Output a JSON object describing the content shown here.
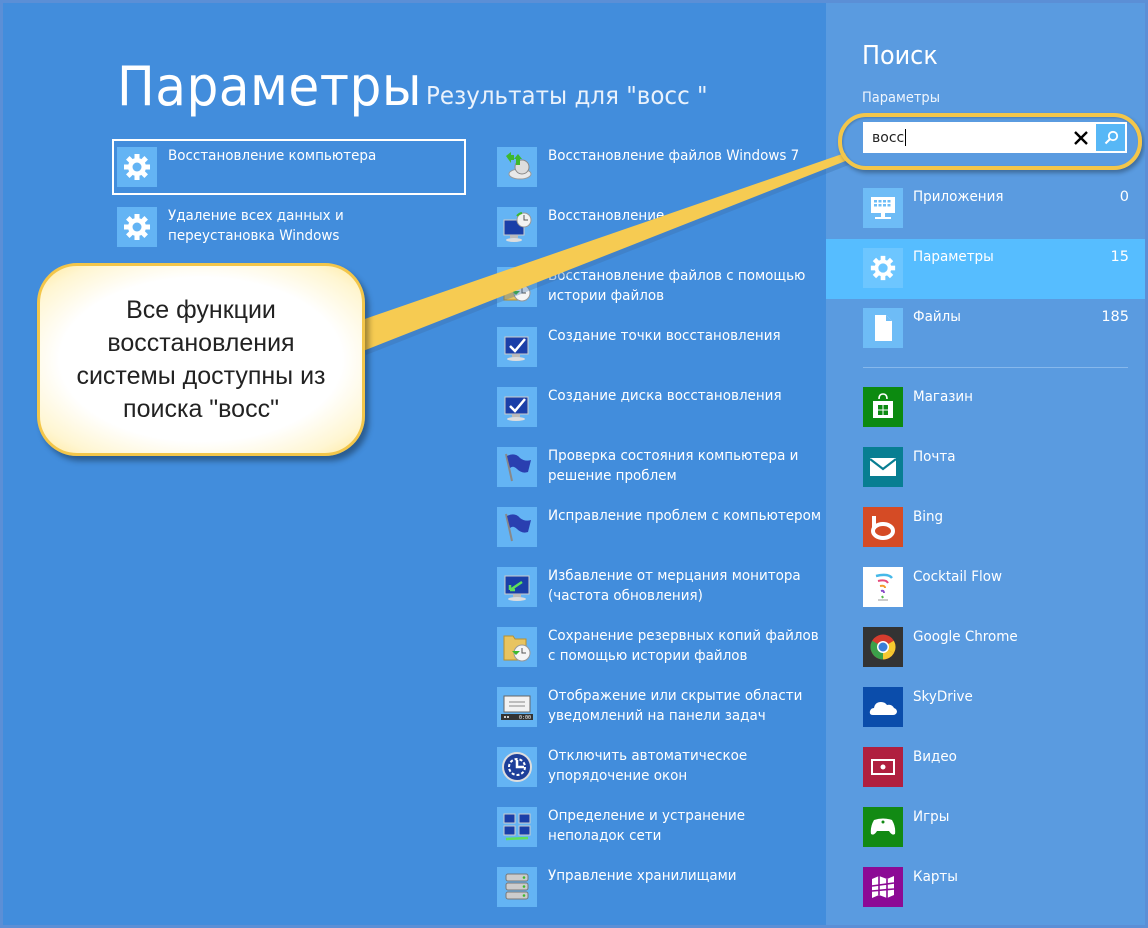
{
  "main": {
    "title": "Параметры",
    "results_heading": "Результаты для \"восс \"",
    "left_column": [
      {
        "label": "Восстановление компьютера",
        "icon": "gear-icon",
        "selected": true
      },
      {
        "label": "Удаление всех данных и переустановка Windows",
        "icon": "gear-icon",
        "selected": false
      }
    ],
    "right_column": [
      {
        "label": "Восстановление файлов Windows 7",
        "icon": "backup-restore-icon"
      },
      {
        "label": "Восстановление",
        "icon": "system-restore-icon"
      },
      {
        "label": "Восстановление файлов с помощью истории файлов",
        "icon": "file-history-icon"
      },
      {
        "label": "Создание точки восстановления",
        "icon": "system-protection-icon"
      },
      {
        "label": "Создание диска восстановления",
        "icon": "recovery-drive-icon"
      },
      {
        "label": "Проверка состояния компьютера и решение проблем",
        "icon": "action-center-flag-icon"
      },
      {
        "label": "Исправление проблем с компьютером",
        "icon": "troubleshoot-flag-icon"
      },
      {
        "label": "Избавление от мерцания монитора (частота обновления)",
        "icon": "display-icon"
      },
      {
        "label": "Сохранение резервных копий файлов с помощью истории файлов",
        "icon": "file-history-icon"
      },
      {
        "label": "Отображение или скрытие области уведомлений на панели задач",
        "icon": "taskbar-icon"
      },
      {
        "label": "Отключить автоматическое упорядочение окон",
        "icon": "ease-of-access-icon"
      },
      {
        "label": "Определение и устранение неполадок сети",
        "icon": "network-icon"
      },
      {
        "label": "Управление хранилищами",
        "icon": "storage-spaces-icon"
      }
    ]
  },
  "search_panel": {
    "title": "Поиск",
    "scope_label": "Параметры",
    "query": "восс",
    "clear_label": "✕",
    "scopes": [
      {
        "name": "Приложения",
        "count": "0",
        "icon": "apps-icon",
        "active": false
      },
      {
        "name": "Параметры",
        "count": "15",
        "icon": "gear-icon",
        "active": true
      },
      {
        "name": "Файлы",
        "count": "185",
        "icon": "file-icon",
        "active": false
      }
    ],
    "apps": [
      {
        "name": "Магазин",
        "icon": "store-icon",
        "color": "#0c8a10"
      },
      {
        "name": "Почта",
        "icon": "mail-icon",
        "color": "#087e92"
      },
      {
        "name": "Bing",
        "icon": "bing-icon",
        "color": "#d54b25"
      },
      {
        "name": "Cocktail Flow",
        "icon": "cocktail-flow-icon",
        "color": "#ffffff"
      },
      {
        "name": "Google Chrome",
        "icon": "chrome-icon",
        "color": "#333333"
      },
      {
        "name": "SkyDrive",
        "icon": "skydrive-icon",
        "color": "#0b4dab"
      },
      {
        "name": "Видео",
        "icon": "video-icon",
        "color": "#b01f3f"
      },
      {
        "name": "Игры",
        "icon": "games-icon",
        "color": "#128a14"
      },
      {
        "name": "Карты",
        "icon": "maps-icon",
        "color": "#8c0a95"
      }
    ]
  },
  "callout": {
    "text": "Все функции восстановления системы доступны из поиска \"восс\""
  },
  "colors": {
    "background": "#428ddc",
    "panel": "#5a9be0",
    "active_scope": "#56bdff",
    "tile": "#64b4f4",
    "highlight": "#f3c64a"
  }
}
